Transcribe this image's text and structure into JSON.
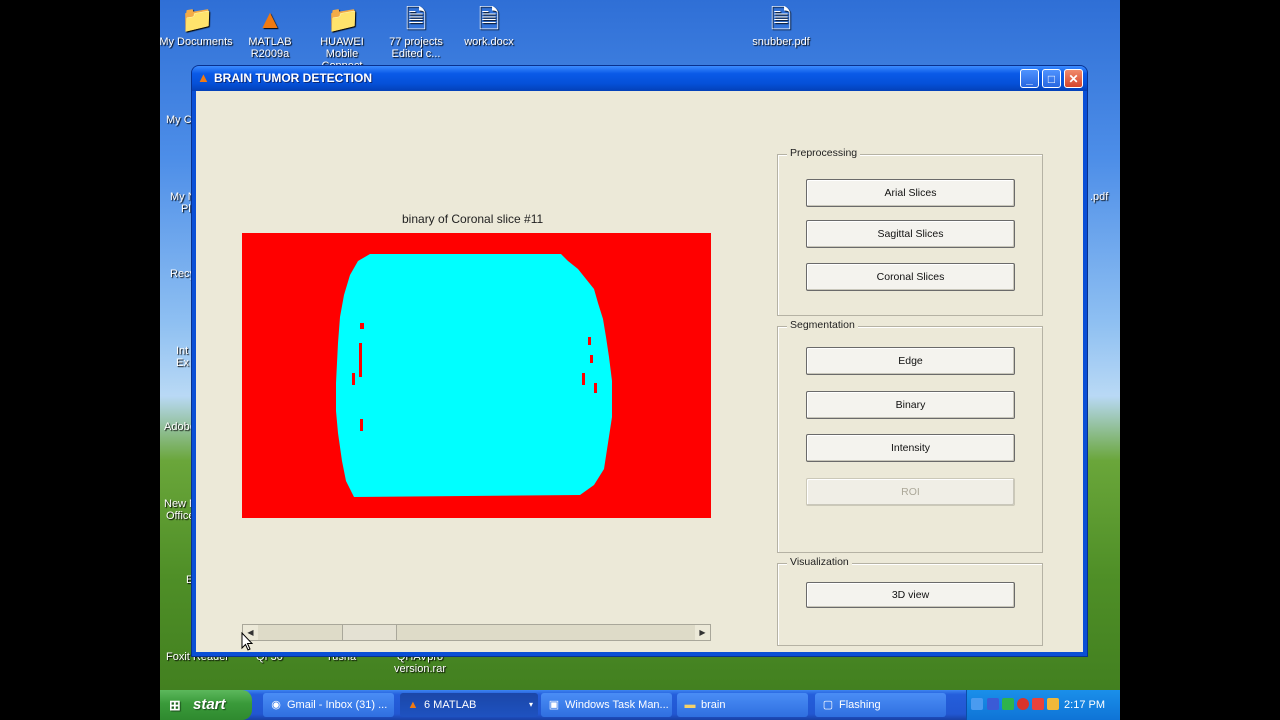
{
  "desktop_icons": [
    {
      "label": "My Documents",
      "icon": "folder-documents-icon"
    },
    {
      "label": "MATLAB R2009a",
      "icon": "matlab-icon"
    },
    {
      "label": "HUAWEI Mobile Connect",
      "icon": "folder-icon"
    },
    {
      "label": "77 projects Edited c...",
      "icon": "word-document-icon"
    },
    {
      "label": "work.docx",
      "icon": "word-document-icon"
    },
    {
      "label": "snubber.pdf",
      "icon": "pdf-icon"
    }
  ],
  "desktop_partial_labels": [
    "My C",
    "My N",
    "Pl",
    "Recy",
    "Int",
    "Ex",
    "Adobe",
    "New M",
    "Office",
    "E",
    "Foxit Reader",
    "QI 30",
    "Tusha",
    "QHAVpro version.rar",
    ".pdf"
  ],
  "window": {
    "title": "BRAIN TUMOR DETECTION",
    "minimize": "_",
    "maximize": "□",
    "close": "✕"
  },
  "axes": {
    "title": "binary of Coronal slice #11"
  },
  "slider": {
    "left_arrow": "◀",
    "right_arrow": "▶",
    "value_fraction": 0.22
  },
  "panels": [
    {
      "title": "Preprocessing",
      "buttons": [
        {
          "label": "Arial Slices",
          "enabled": true
        },
        {
          "label": "Sagittal Slices",
          "enabled": true
        },
        {
          "label": "Coronal Slices",
          "enabled": true
        }
      ]
    },
    {
      "title": "Segmentation",
      "buttons": [
        {
          "label": "Edge",
          "enabled": true
        },
        {
          "label": "Binary",
          "enabled": true
        },
        {
          "label": "Intensity",
          "enabled": true
        },
        {
          "label": "ROI",
          "enabled": false
        }
      ]
    },
    {
      "title": "Visualization",
      "buttons": [
        {
          "label": "3D view",
          "enabled": true
        }
      ]
    }
  ],
  "colors": {
    "background_region": "#ff0000",
    "brain_region": "#00ffff"
  },
  "taskbar": {
    "start_label": "start",
    "tasks": [
      {
        "label": "Gmail - Inbox (31) ...",
        "icon": "chrome-icon",
        "active": false
      },
      {
        "label": "6 MATLAB",
        "icon": "matlab-icon",
        "active": true
      },
      {
        "label": "Windows Task Man...",
        "icon": "task-manager-icon",
        "active": false
      },
      {
        "label": "brain",
        "icon": "folder-icon",
        "active": false
      },
      {
        "label": "Flashing",
        "icon": "window-icon",
        "active": false
      }
    ],
    "clock": "2:17 PM"
  }
}
